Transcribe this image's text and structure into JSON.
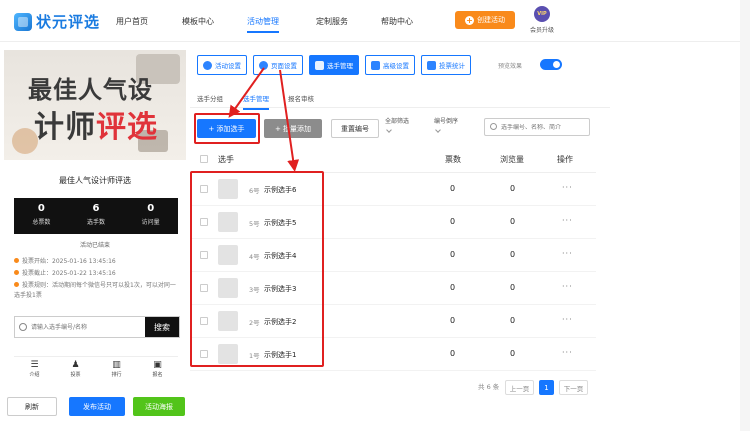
{
  "nav": {
    "logo_text": "状元评选",
    "items": [
      "用户首页",
      "模板中心",
      "活动管理",
      "定制服务",
      "帮助中心"
    ],
    "active_index": 2,
    "create_label": "创建活动",
    "vip_badge": "VIP",
    "vip_label": "会员升级"
  },
  "preview": {
    "banner_line1_a": "最佳",
    "banner_line1_b": "人气设",
    "banner_line2_a": "计师",
    "banner_line2_b": "评选",
    "event_title": "最佳人气设计师评选",
    "stats": [
      {
        "num": "0",
        "label": "总票数"
      },
      {
        "num": "6",
        "label": "选手数"
      },
      {
        "num": "0",
        "label": "访问量"
      }
    ],
    "ended": "活动已结束",
    "info": [
      "投票开始：2025-01-16 13:45:16",
      "投票截止：2025-01-22 13:45:16",
      "投票规则：活动期间每个微信号只可以投1次，可以对同一选手投1票"
    ],
    "search_placeholder": "请输入选手编号/名称",
    "search_btn": "搜索",
    "tabbar": [
      {
        "icon": "☰",
        "label": "介绍"
      },
      {
        "icon": "♟",
        "label": "投票"
      },
      {
        "icon": "▥",
        "label": "排行"
      },
      {
        "icon": "▣",
        "label": "报名"
      }
    ],
    "refresh": "刷新",
    "publish": "发布活动",
    "poster": "活动海报"
  },
  "toolbar": {
    "buttons": [
      "活动设置",
      "页面设置",
      "选手管理",
      "高级设置",
      "投票统计"
    ],
    "active_index": 2,
    "preview_label": "预览效果",
    "preview_on": true
  },
  "subtabs": {
    "items": [
      "选手分组",
      "选手管理",
      "报名审核"
    ],
    "active_index": 1
  },
  "actions": {
    "add": "+ 添加选手",
    "batch": "+ 批量添加",
    "reorder": "重置编号",
    "filter_all": "全部筛选",
    "filter_sort": "编号倒序",
    "search_placeholder": "选手编号、名称、简介"
  },
  "table": {
    "headers": [
      "选手",
      "票数",
      "浏览量",
      "操作"
    ],
    "rows": [
      {
        "num": "6号",
        "name": "示例选手6",
        "votes": "0",
        "views": "0",
        "op": "···"
      },
      {
        "num": "5号",
        "name": "示例选手5",
        "votes": "0",
        "views": "0",
        "op": "···"
      },
      {
        "num": "4号",
        "name": "示例选手4",
        "votes": "0",
        "views": "0",
        "op": "···"
      },
      {
        "num": "3号",
        "name": "示例选手3",
        "votes": "0",
        "views": "0",
        "op": "···"
      },
      {
        "num": "2号",
        "name": "示例选手2",
        "votes": "0",
        "views": "0",
        "op": "···"
      },
      {
        "num": "1号",
        "name": "示例选手1",
        "votes": "0",
        "views": "0",
        "op": "···"
      }
    ]
  },
  "pager": {
    "total": "共 6 条",
    "prev": "上一页",
    "current": "1",
    "next": "下一页"
  },
  "colors": {
    "primary": "#1677ff",
    "orange": "#f98a1b",
    "green": "#52c41a",
    "highlight": "#e02020"
  }
}
